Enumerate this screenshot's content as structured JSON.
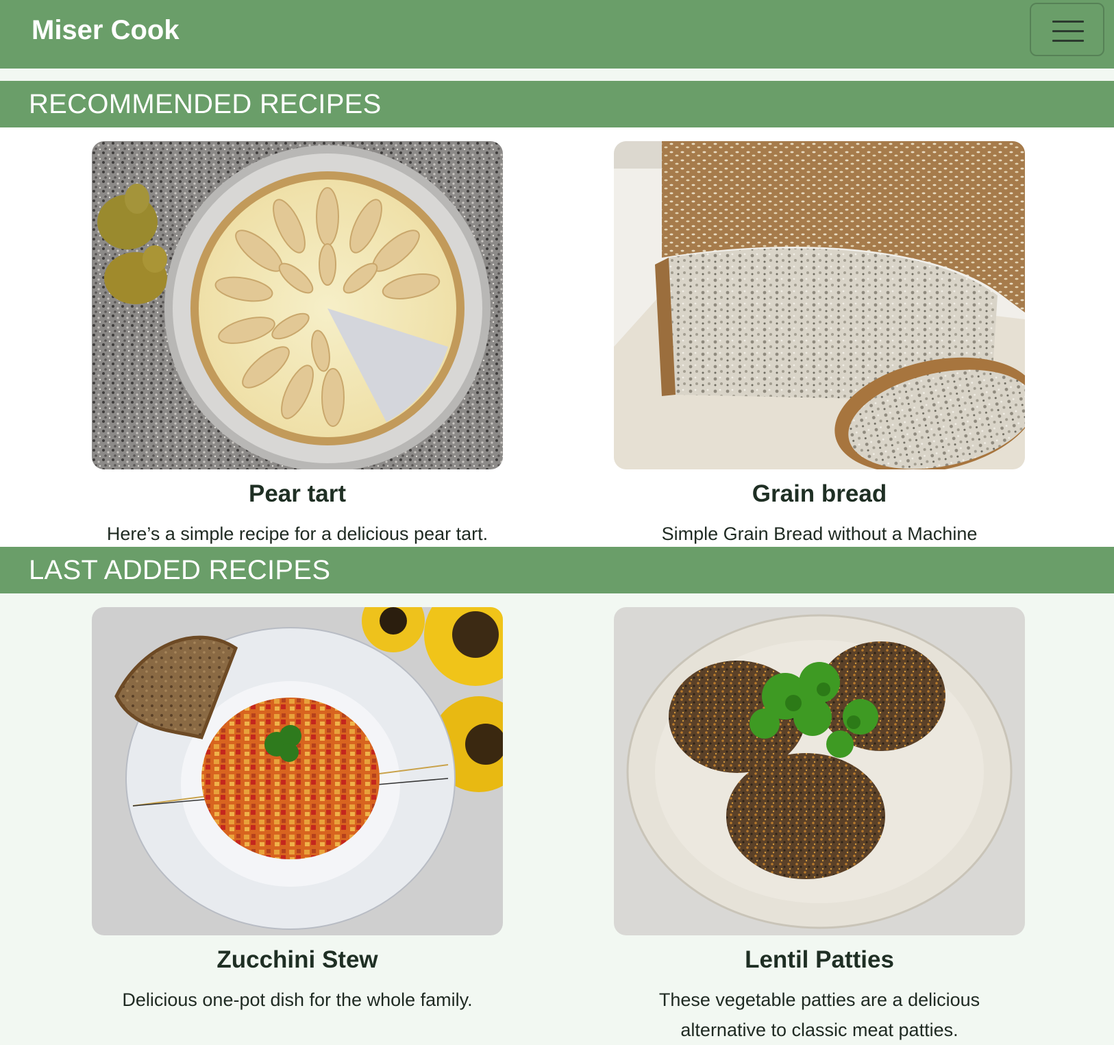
{
  "navbar": {
    "brand": "Miser Cook",
    "menu_icon": "hamburger-menu-icon"
  },
  "sections": {
    "recommended": {
      "title": "RECOMMENDED RECIPES",
      "recipes": [
        {
          "title": "Pear tart",
          "description": "Here’s a simple recipe for a delicious pear tart."
        },
        {
          "title": "Grain bread",
          "description": "Simple Grain Bread without a Machine"
        }
      ]
    },
    "last_added": {
      "title": "LAST ADDED RECIPES",
      "recipes": [
        {
          "title": "Zucchini Stew",
          "description": "Delicious one-pot dish for the whole family."
        },
        {
          "title": "Lentil Patties",
          "description": "These vegetable patties are a delicious alternative to classic meat patties."
        }
      ]
    }
  },
  "colors": {
    "accent": "#6a9e69",
    "page_background": "#f2f8f2",
    "text": "#1f2a22"
  }
}
